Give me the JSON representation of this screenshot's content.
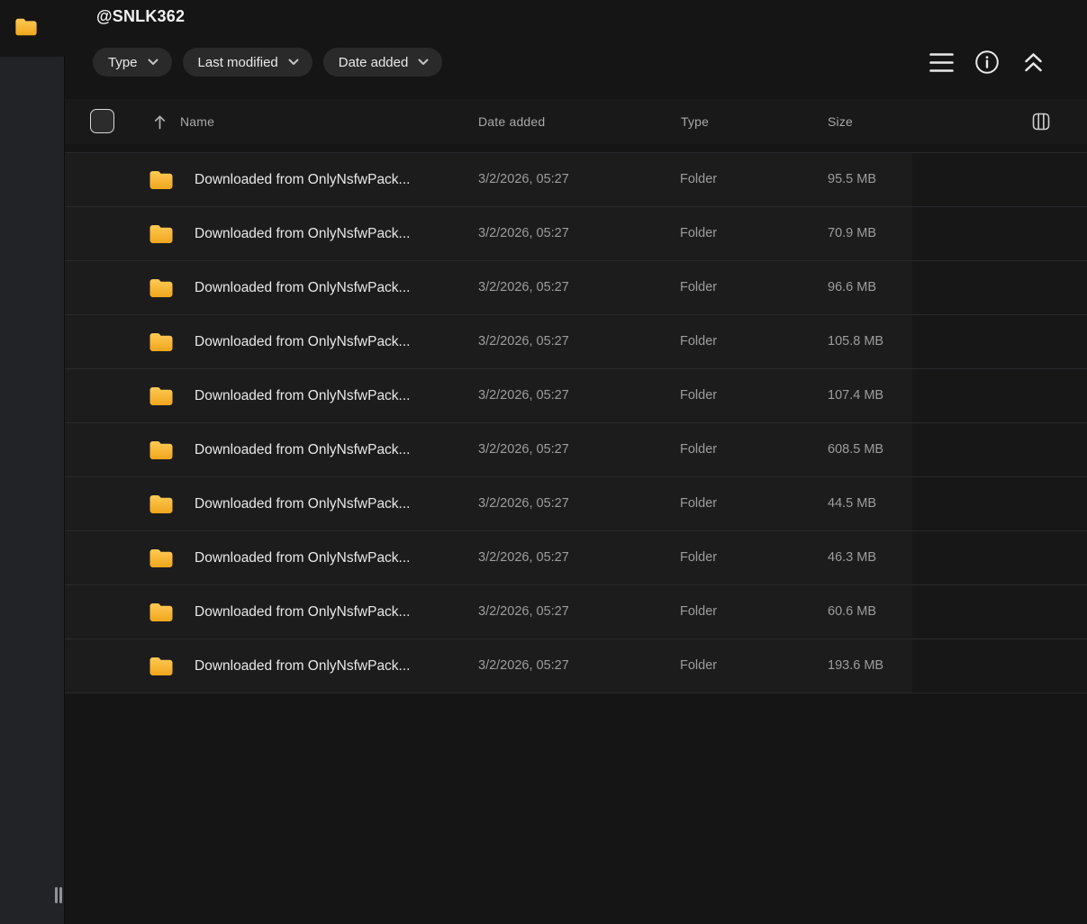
{
  "app": {
    "title": "@SNLK362"
  },
  "colors": {
    "page_bg": "#151516",
    "sidebar_bg": "#222327",
    "row_bg": "#1c1c1d",
    "divider": "#29292b",
    "chip_bg": "#2a2a2b",
    "folder_gradient_top": "#FFCA55",
    "folder_gradient_bottom": "#F0A61C",
    "primary_text": "#e8e8e8",
    "secondary_text": "#9d9d9d"
  },
  "icons": {
    "app": "folder-icon",
    "toolbar": [
      "hamburger-menu-icon",
      "info-icon",
      "double-chevron-up-icon"
    ],
    "table": [
      "checkbox",
      "arrow-up-sort-icon",
      "columns-icon"
    ],
    "row": "folder-icon",
    "chip": "chevron-down-icon",
    "sidebar_bottom": "resize-handle"
  },
  "filters": [
    {
      "label": "Type"
    },
    {
      "label": "Last modified"
    },
    {
      "label": "Date added"
    }
  ],
  "table": {
    "columns": {
      "name": "Name",
      "date_added": "Date added",
      "type": "Type",
      "size": "Size"
    },
    "sort_column": "Name",
    "sort_direction": "ascending",
    "rows": [
      {
        "name": "Downloaded from OnlyNsfwPack...",
        "date_added": "3/2/2026, 05:27",
        "type": "Folder",
        "size": "95.5 MB"
      },
      {
        "name": "Downloaded from OnlyNsfwPack...",
        "date_added": "3/2/2026, 05:27",
        "type": "Folder",
        "size": "70.9 MB"
      },
      {
        "name": "Downloaded from OnlyNsfwPack...",
        "date_added": "3/2/2026, 05:27",
        "type": "Folder",
        "size": "96.6 MB"
      },
      {
        "name": "Downloaded from OnlyNsfwPack...",
        "date_added": "3/2/2026, 05:27",
        "type": "Folder",
        "size": "105.8 MB"
      },
      {
        "name": "Downloaded from OnlyNsfwPack...",
        "date_added": "3/2/2026, 05:27",
        "type": "Folder",
        "size": "107.4 MB"
      },
      {
        "name": "Downloaded from OnlyNsfwPack...",
        "date_added": "3/2/2026, 05:27",
        "type": "Folder",
        "size": "608.5 MB"
      },
      {
        "name": "Downloaded from OnlyNsfwPack...",
        "date_added": "3/2/2026, 05:27",
        "type": "Folder",
        "size": "44.5 MB"
      },
      {
        "name": "Downloaded from OnlyNsfwPack...",
        "date_added": "3/2/2026, 05:27",
        "type": "Folder",
        "size": "46.3 MB"
      },
      {
        "name": "Downloaded from OnlyNsfwPack...",
        "date_added": "3/2/2026, 05:27",
        "type": "Folder",
        "size": "60.6 MB"
      },
      {
        "name": "Downloaded from OnlyNsfwPack...",
        "date_added": "3/2/2026, 05:27",
        "type": "Folder",
        "size": "193.6 MB"
      }
    ]
  }
}
